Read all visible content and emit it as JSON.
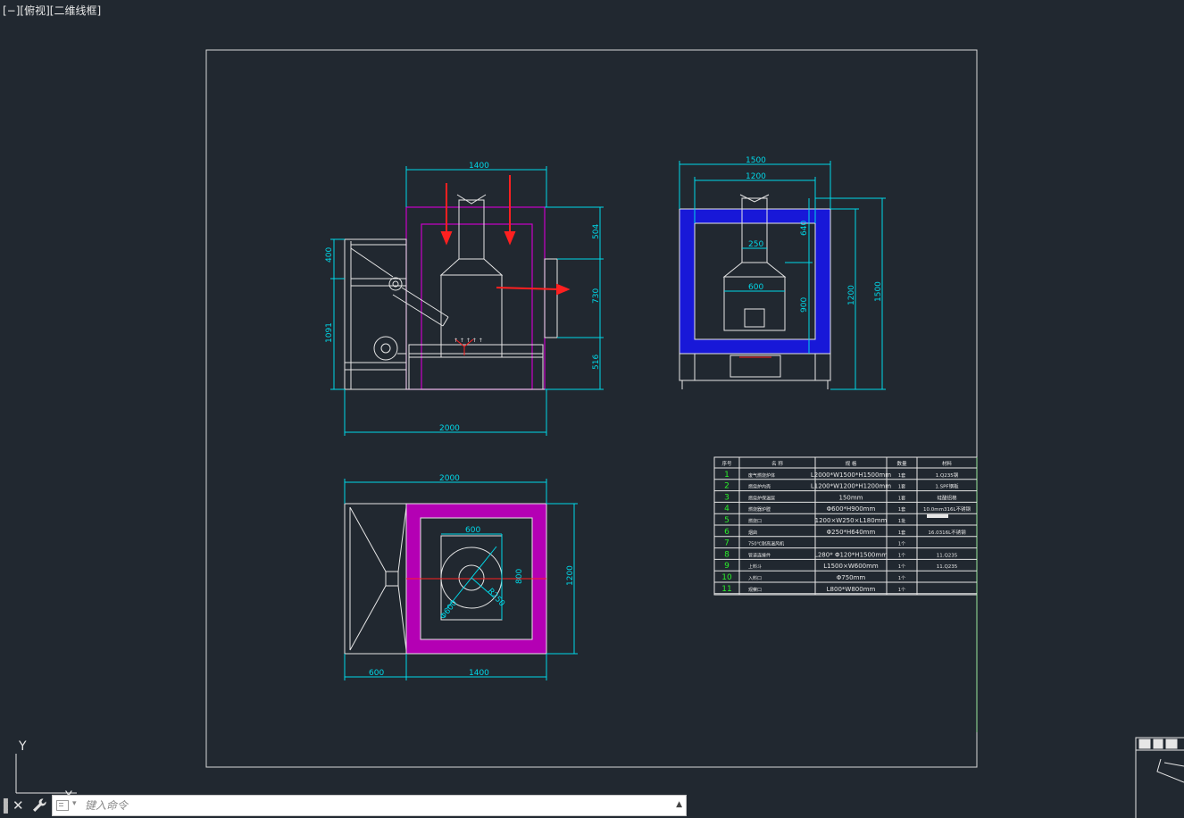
{
  "viewport": {
    "label": "[−][俯视][二维线框]"
  },
  "colors": {
    "background": "#212830",
    "frame": "#d8d8d8",
    "dimension": "#00d8e8",
    "outline": "#e6e6e6",
    "magenta": "#c800c8",
    "blue_fill": "#1818d8",
    "red_arrow": "#ff2020",
    "table_id": "#2af02a"
  },
  "views": {
    "front": {
      "dims": {
        "top": "1400",
        "bottom": "2000",
        "left_upper": "400",
        "left_lower": "1091",
        "right_top": "504",
        "right_mid": "730",
        "right_bottom": "516"
      }
    },
    "side": {
      "dims": {
        "top_outer": "1500",
        "top_inner": "1200",
        "inner_width": "250",
        "body_width": "600",
        "inner_top": "640",
        "inner_mid": "900",
        "right_inner": "1200",
        "right_outer": "1500"
      }
    },
    "plan": {
      "dims": {
        "top": "2000",
        "inner_top": "600",
        "inner_right": "800",
        "outer_right": "1200",
        "diag": "Φ600",
        "radius": "R250",
        "bottom_left": "600",
        "bottom_right": "1400"
      }
    }
  },
  "table": {
    "headers": [
      "序号",
      "名 称",
      "规 格",
      "数量",
      "材料"
    ],
    "rows": [
      {
        "id": "1",
        "name": "废气燃烧炉体",
        "spec": "L2000*W1500*H1500mm",
        "qty": "1套",
        "mat": "1.Q235钢"
      },
      {
        "id": "2",
        "name": "燃烧炉内壳",
        "spec": "L1200*W1200*H1200mm",
        "qty": "1套",
        "mat": "1.SPF钢板"
      },
      {
        "id": "3",
        "name": "燃烧炉保温层",
        "spec": "150mm",
        "qty": "1套",
        "mat": "硅酸铝棉"
      },
      {
        "id": "4",
        "name": "燃烧器炉膛",
        "spec": "Φ600*H900mm",
        "qty": "1套",
        "mat": "10.0mm316L不锈钢"
      },
      {
        "id": "5",
        "name": "燃烧口",
        "spec": "1200×W250×L180mm",
        "qty": "1批",
        "mat": ""
      },
      {
        "id": "6",
        "name": "烟囱",
        "spec": "Φ250*H640mm",
        "qty": "1套",
        "mat": "16.0316L不锈钢"
      },
      {
        "id": "7",
        "name": "750℃耐高温风机",
        "spec": "",
        "qty": "1个",
        "mat": ""
      },
      {
        "id": "8",
        "name": "管道连接件",
        "spec": "L280* Φ120*H1500mm",
        "qty": "1个",
        "mat": "11.Q235"
      },
      {
        "id": "9",
        "name": "上料斗",
        "spec": "L1500×W600mm",
        "qty": "1个",
        "mat": "11.Q235"
      },
      {
        "id": "10",
        "name": "入料口",
        "spec": "Φ750mm",
        "qty": "1个",
        "mat": ""
      },
      {
        "id": "11",
        "name": "观察口",
        "spec": "L800*W800mm",
        "qty": "1个",
        "mat": ""
      }
    ]
  },
  "ucs": {
    "axis_y": "Y",
    "axis_x": "X"
  },
  "command": {
    "placeholder": "键入命令",
    "close_icon": "close-icon",
    "wrench_icon": "wrench-icon"
  }
}
